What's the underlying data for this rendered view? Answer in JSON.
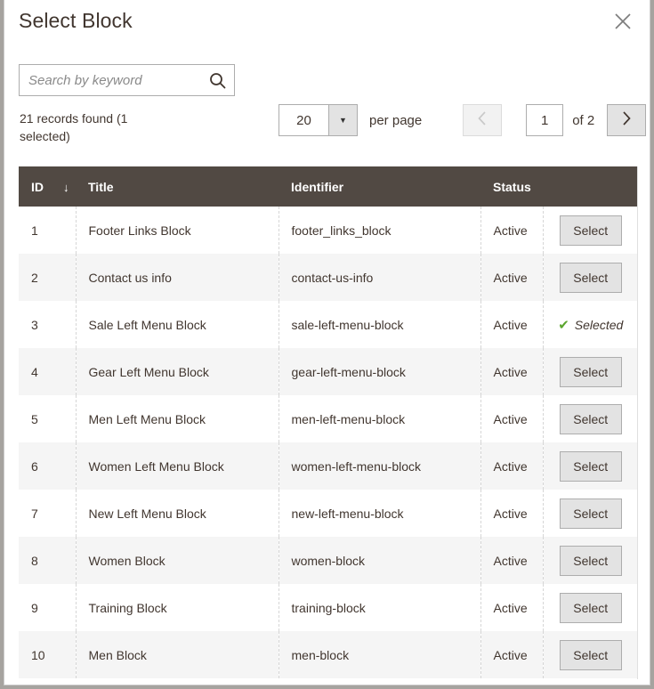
{
  "dialog": {
    "title": "Select Block",
    "close_icon": "close-icon"
  },
  "search": {
    "placeholder": "Search by keyword",
    "value": "",
    "icon": "search-icon"
  },
  "summary": {
    "records_text": "21 records found (1 selected)"
  },
  "pager": {
    "limit_value": "20",
    "limit_arrow_icon": "chevron-down-icon",
    "per_page_label": "per page",
    "prev_icon": "chevron-left-icon",
    "next_icon": "chevron-right-icon",
    "page_value": "1",
    "of_total": "of 2"
  },
  "table": {
    "columns": [
      {
        "key": "id",
        "label": "ID",
        "sort": "↓"
      },
      {
        "key": "title",
        "label": "Title"
      },
      {
        "key": "identifier",
        "label": "Identifier"
      },
      {
        "key": "status",
        "label": "Status"
      },
      {
        "key": "action",
        "label": ""
      }
    ],
    "select_label": "Select",
    "selected_label": "Selected",
    "rows": [
      {
        "id": "1",
        "title": "Footer Links Block",
        "identifier": "footer_links_block",
        "status": "Active",
        "selected": false
      },
      {
        "id": "2",
        "title": "Contact us info",
        "identifier": "contact-us-info",
        "status": "Active",
        "selected": false
      },
      {
        "id": "3",
        "title": "Sale Left Menu Block",
        "identifier": "sale-left-menu-block",
        "status": "Active",
        "selected": true
      },
      {
        "id": "4",
        "title": "Gear Left Menu Block",
        "identifier": "gear-left-menu-block",
        "status": "Active",
        "selected": false
      },
      {
        "id": "5",
        "title": "Men Left Menu Block",
        "identifier": "men-left-menu-block",
        "status": "Active",
        "selected": false
      },
      {
        "id": "6",
        "title": "Women Left Menu Block",
        "identifier": "women-left-menu-block",
        "status": "Active",
        "selected": false
      },
      {
        "id": "7",
        "title": "New Left Menu Block",
        "identifier": "new-left-menu-block",
        "status": "Active",
        "selected": false
      },
      {
        "id": "8",
        "title": "Women Block",
        "identifier": "women-block",
        "status": "Active",
        "selected": false
      },
      {
        "id": "9",
        "title": "Training Block",
        "identifier": "training-block",
        "status": "Active",
        "selected": false
      },
      {
        "id": "10",
        "title": "Men Block",
        "identifier": "men-block",
        "status": "Active",
        "selected": false
      }
    ]
  },
  "colors": {
    "header_bg": "#514943",
    "text": "#41362f",
    "stripe": "#f5f5f5",
    "button_bg": "#e3e3e3",
    "check_green": "#5ba52e",
    "page_backdrop": "#a6a39f"
  }
}
